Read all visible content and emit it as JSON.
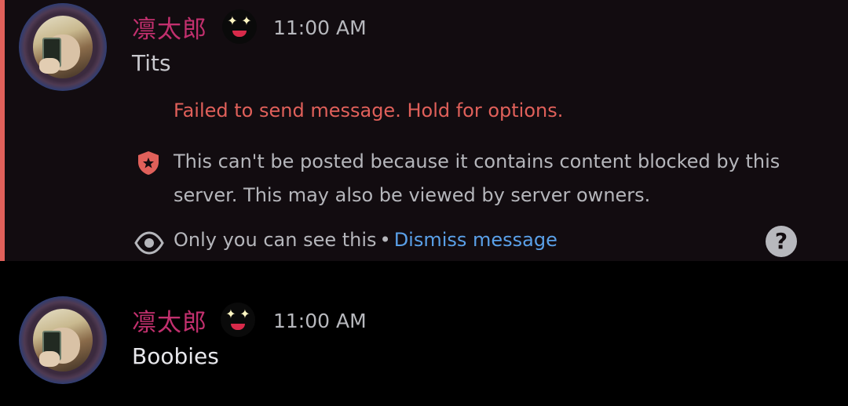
{
  "messages": [
    {
      "username": "凛太郎",
      "timestamp": "11:00 AM",
      "content": "Tits",
      "status": "failed",
      "accent_color": "#e0605a",
      "error": "Failed to send message. Hold for options.",
      "blocked_notice": "This can't be posted because it contains content blocked by this server. This may also be viewed by server owners.",
      "ephemeral_label": "Only you can see this",
      "bullet": "•",
      "dismiss_label": "Dismiss message",
      "help_glyph": "?"
    },
    {
      "username": "凛太郎",
      "timestamp": "11:00 AM",
      "content": "Boobies",
      "status": "sent"
    }
  ],
  "colors": {
    "username": "#c2306e",
    "error": "#e0605a",
    "link": "#5aa0e8",
    "muted_text": "#b5b6bb"
  },
  "icons": {
    "badge": "sparkle-eyes-emoji",
    "shield": "shield-star-icon",
    "eye": "eye-icon",
    "help": "question-circle-icon"
  }
}
